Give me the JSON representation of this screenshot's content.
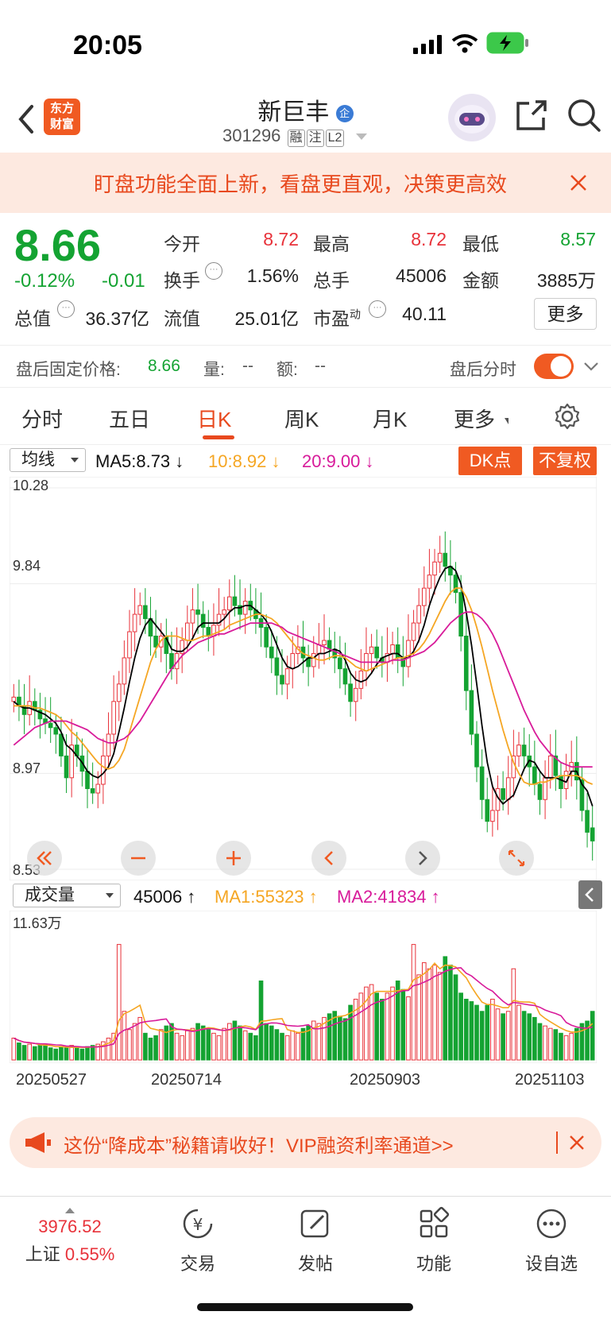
{
  "status_bar": {
    "time": "20:05"
  },
  "header": {
    "logo_text": "东方\n财富",
    "stock_name": "新巨丰",
    "stock_code": "301296",
    "tags": [
      "融",
      "注",
      "L2"
    ]
  },
  "banner": {
    "text": "盯盘功能全面上新，看盘更直观，决策更高效"
  },
  "quote": {
    "price": "8.66",
    "change_pct": "-0.12%",
    "change_amt": "-0.01",
    "open_label": "今开",
    "open": "8.72",
    "high_label": "最高",
    "high": "8.72",
    "low_label": "最低",
    "low": "8.57",
    "turnover_label": "换手",
    "turnover": "1.56%",
    "volume_label": "总手",
    "volume": "45006",
    "amount_label": "金额",
    "amount": "3885万",
    "total_value_label": "总值",
    "total_value": "36.37亿",
    "float_value_label": "流值",
    "float_value": "25.01亿",
    "pe_label": "市盈",
    "pe_sup": "动",
    "pe": "40.11",
    "more_label": "更多"
  },
  "after_hours": {
    "price_label": "盘后固定价格:",
    "price": "8.66",
    "vol_label": "量:",
    "vol": "--",
    "amt_label": "额:",
    "amt": "--",
    "timeshare_label": "盘后分时"
  },
  "tabs": [
    "分时",
    "五日",
    "日K",
    "周K",
    "月K",
    "更多"
  ],
  "active_tab": 2,
  "ma_bar": {
    "select": "均线",
    "ma5": "MA5:8.73",
    "ma10": "10:8.92",
    "ma20": "20:9.00",
    "dk_button": "DK点",
    "adjust_button": "不复权"
  },
  "volume_bar": {
    "select": "成交量",
    "vol": "45006",
    "ma1": "MA1:55323",
    "ma2": "MA2:41834",
    "max_label": "11.63万"
  },
  "colors": {
    "up": "#e8323a",
    "down": "#14a332",
    "ma5": "#000000",
    "ma10": "#f5a623",
    "ma20": "#d81b9a",
    "accent": "#f05a22"
  },
  "chart_data": {
    "type": "candlestick",
    "y_ticks": [
      "10.28",
      "9.84",
      "8.97",
      "8.53"
    ],
    "ylim": [
      8.53,
      10.28
    ],
    "x_ticks": [
      "20250527",
      "20250714",
      "20250903",
      "20251103"
    ],
    "close": [
      9.32,
      9.28,
      9.24,
      9.3,
      9.26,
      9.22,
      9.2,
      9.18,
      9.15,
      9.05,
      8.95,
      9.1,
      9.05,
      8.98,
      8.9,
      8.88,
      8.92,
      9.05,
      9.15,
      9.3,
      9.38,
      9.5,
      9.62,
      9.7,
      9.74,
      9.68,
      9.6,
      9.55,
      9.6,
      9.52,
      9.45,
      9.52,
      9.58,
      9.66,
      9.72,
      9.7,
      9.64,
      9.6,
      9.65,
      9.7,
      9.72,
      9.78,
      9.74,
      9.7,
      9.76,
      9.72,
      9.68,
      9.64,
      9.55,
      9.5,
      9.42,
      9.38,
      9.45,
      9.52,
      9.55,
      9.5,
      9.46,
      9.52,
      9.56,
      9.58,
      9.54,
      9.5,
      9.45,
      9.38,
      9.3,
      9.36,
      9.44,
      9.52,
      9.55,
      9.5,
      9.48,
      9.52,
      9.56,
      9.5,
      9.46,
      9.58,
      9.66,
      9.74,
      9.82,
      9.88,
      9.94,
      9.98,
      9.92,
      9.88,
      9.8,
      9.6,
      9.35,
      9.15,
      9.0,
      8.85,
      8.75,
      8.8,
      8.9,
      8.85,
      8.95,
      9.05,
      9.1,
      9.05,
      9.0,
      8.92,
      8.85,
      8.95,
      9.05,
      8.96,
      8.9,
      8.98,
      9.02,
      8.94,
      8.8,
      8.7,
      8.66
    ],
    "open": [
      9.3,
      9.32,
      9.28,
      9.24,
      9.3,
      9.26,
      9.22,
      9.2,
      9.18,
      9.15,
      9.05,
      8.95,
      9.1,
      9.05,
      8.98,
      8.9,
      8.88,
      8.92,
      9.05,
      9.15,
      9.3,
      9.38,
      9.5,
      9.62,
      9.7,
      9.74,
      9.68,
      9.6,
      9.55,
      9.6,
      9.52,
      9.45,
      9.52,
      9.58,
      9.66,
      9.72,
      9.7,
      9.64,
      9.6,
      9.65,
      9.7,
      9.72,
      9.78,
      9.74,
      9.7,
      9.76,
      9.72,
      9.68,
      9.64,
      9.55,
      9.5,
      9.42,
      9.38,
      9.45,
      9.52,
      9.55,
      9.5,
      9.46,
      9.52,
      9.56,
      9.58,
      9.54,
      9.5,
      9.45,
      9.38,
      9.3,
      9.36,
      9.44,
      9.52,
      9.55,
      9.5,
      9.48,
      9.52,
      9.56,
      9.5,
      9.46,
      9.58,
      9.66,
      9.74,
      9.82,
      9.88,
      9.94,
      9.98,
      9.92,
      9.88,
      9.8,
      9.6,
      9.35,
      9.15,
      9.0,
      8.85,
      8.75,
      8.8,
      8.9,
      8.85,
      8.95,
      9.05,
      9.1,
      9.05,
      9.0,
      8.92,
      8.85,
      8.95,
      9.05,
      8.96,
      8.9,
      8.98,
      9.02,
      8.94,
      8.8,
      8.72
    ],
    "ma5": [
      9.3,
      9.28,
      9.27,
      9.27,
      9.26,
      9.25,
      9.24,
      9.22,
      9.2,
      9.16,
      9.1,
      9.08,
      9.05,
      9.02,
      8.98,
      8.96,
      8.95,
      8.97,
      9.0,
      9.06,
      9.16,
      9.27,
      9.39,
      9.5,
      9.59,
      9.65,
      9.68,
      9.65,
      9.62,
      9.59,
      9.54,
      9.53,
      9.53,
      9.55,
      9.59,
      9.64,
      9.66,
      9.66,
      9.66,
      9.66,
      9.68,
      9.71,
      9.73,
      9.73,
      9.74,
      9.74,
      9.72,
      9.7,
      9.67,
      9.62,
      9.56,
      9.5,
      9.46,
      9.45,
      9.46,
      9.48,
      9.5,
      9.5,
      9.52,
      9.52,
      9.53,
      9.54,
      9.53,
      9.49,
      9.43,
      9.4,
      9.39,
      9.4,
      9.43,
      9.47,
      9.5,
      9.51,
      9.52,
      9.52,
      9.5,
      9.5,
      9.53,
      9.58,
      9.65,
      9.74,
      9.81,
      9.87,
      9.91,
      9.92,
      9.9,
      9.84,
      9.71,
      9.56,
      9.38,
      9.19,
      9.02,
      8.91,
      8.86,
      8.83,
      8.85,
      8.87,
      8.93,
      8.99,
      9.03,
      9.02,
      8.98,
      8.95,
      8.95,
      8.95,
      8.94,
      8.93,
      8.98,
      8.98,
      8.92,
      8.89,
      8.82
    ],
    "ma10": [
      9.28,
      9.28,
      9.28,
      9.28,
      9.27,
      9.27,
      9.26,
      9.25,
      9.24,
      9.22,
      9.19,
      9.16,
      9.14,
      9.11,
      9.08,
      9.05,
      9.02,
      9.0,
      8.99,
      9.0,
      9.03,
      9.08,
      9.16,
      9.24,
      9.32,
      9.4,
      9.48,
      9.54,
      9.58,
      9.6,
      9.6,
      9.6,
      9.59,
      9.58,
      9.58,
      9.59,
      9.6,
      9.6,
      9.61,
      9.62,
      9.63,
      9.65,
      9.66,
      9.67,
      9.68,
      9.69,
      9.7,
      9.7,
      9.69,
      9.68,
      9.66,
      9.63,
      9.6,
      9.57,
      9.54,
      9.52,
      9.51,
      9.5,
      9.49,
      9.49,
      9.5,
      9.51,
      9.51,
      9.5,
      9.48,
      9.46,
      9.45,
      9.44,
      9.45,
      9.46,
      9.47,
      9.48,
      9.49,
      9.5,
      9.5,
      9.51,
      9.52,
      9.54,
      9.57,
      9.61,
      9.66,
      9.71,
      9.76,
      9.8,
      9.82,
      9.82,
      9.78,
      9.72,
      9.64,
      9.55,
      9.45,
      9.35,
      9.26,
      9.17,
      9.09,
      9.02,
      8.97,
      8.93,
      8.92,
      8.92,
      8.93,
      8.93,
      8.94,
      8.95,
      8.96,
      8.96,
      8.96,
      8.96,
      8.95,
      8.93,
      8.92
    ],
    "ma20": [
      9.1,
      9.12,
      9.14,
      9.16,
      9.18,
      9.19,
      9.2,
      9.21,
      9.21,
      9.21,
      9.21,
      9.2,
      9.19,
      9.18,
      9.17,
      9.15,
      9.13,
      9.12,
      9.11,
      9.11,
      9.12,
      9.13,
      9.15,
      9.18,
      9.21,
      9.25,
      9.29,
      9.33,
      9.37,
      9.41,
      9.45,
      9.48,
      9.51,
      9.53,
      9.55,
      9.57,
      9.58,
      9.59,
      9.6,
      9.61,
      9.61,
      9.62,
      9.63,
      9.64,
      9.65,
      9.66,
      9.66,
      9.66,
      9.66,
      9.66,
      9.65,
      9.64,
      9.62,
      9.61,
      9.6,
      9.59,
      9.58,
      9.57,
      9.56,
      9.55,
      9.54,
      9.53,
      9.52,
      9.51,
      9.5,
      9.49,
      9.48,
      9.48,
      9.48,
      9.48,
      9.48,
      9.48,
      9.49,
      9.49,
      9.49,
      9.5,
      9.51,
      9.52,
      9.53,
      9.55,
      9.57,
      9.6,
      9.63,
      9.66,
      9.68,
      9.7,
      9.71,
      9.71,
      9.7,
      9.68,
      9.65,
      9.61,
      9.56,
      9.5,
      9.44,
      9.38,
      9.32,
      9.26,
      9.21,
      9.16,
      9.12,
      9.09,
      9.06,
      9.04,
      9.02,
      9.01,
      9.0,
      9.0,
      9.0,
      9.0,
      9.0
    ],
    "volume": [
      18,
      14,
      12,
      13,
      11,
      12,
      13,
      10,
      9,
      11,
      10,
      12,
      10,
      9,
      11,
      12,
      13,
      15,
      18,
      22,
      95,
      40,
      25,
      30,
      35,
      22,
      18,
      20,
      25,
      28,
      30,
      22,
      20,
      24,
      26,
      30,
      28,
      25,
      22,
      20,
      26,
      30,
      32,
      28,
      24,
      22,
      20,
      65,
      30,
      28,
      25,
      22,
      20,
      24,
      22,
      26,
      28,
      32,
      30,
      35,
      38,
      40,
      36,
      34,
      45,
      50,
      55,
      60,
      62,
      55,
      50,
      55,
      60,
      65,
      58,
      52,
      95,
      70,
      80,
      75,
      78,
      72,
      85,
      78,
      70,
      55,
      50,
      48,
      45,
      40,
      45,
      50,
      42,
      38,
      40,
      75,
      45,
      40,
      38,
      35,
      30,
      28,
      26,
      25,
      22,
      20,
      22,
      26,
      30,
      32,
      40
    ]
  }
}
